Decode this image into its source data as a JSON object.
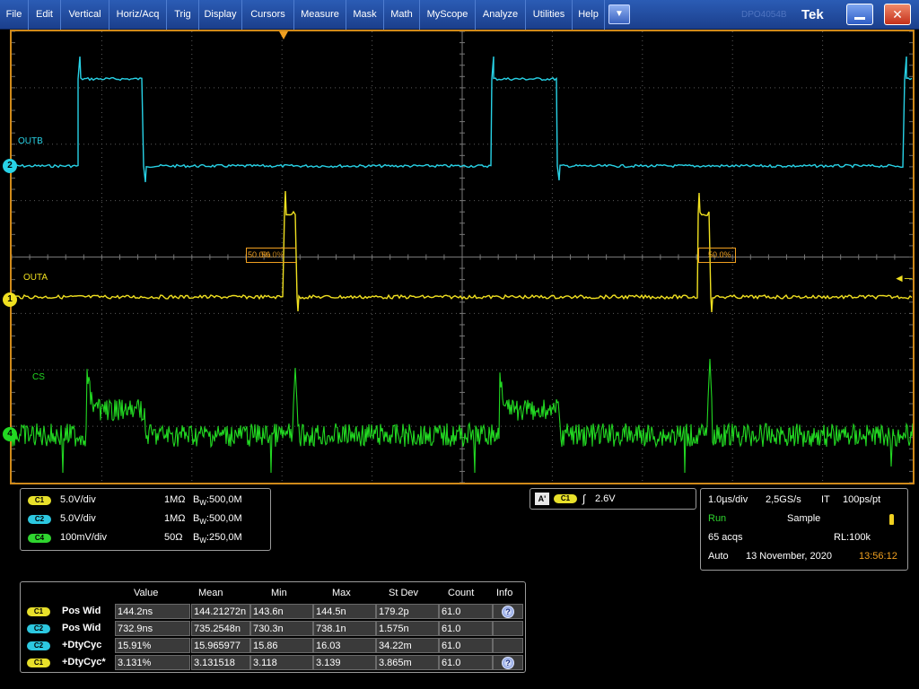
{
  "menu": {
    "items": [
      "File",
      "Edit",
      "Vertical",
      "Horiz/Acq",
      "Trig",
      "Display",
      "Cursors",
      "Measure",
      "Mask",
      "Math",
      "MyScope",
      "Analyze",
      "Utilities",
      "Help"
    ],
    "dropdown_icon": "chevron-down-icon",
    "brand": "Tek",
    "ghost_label": "DPO4054B"
  },
  "channels": {
    "ch1": {
      "marker": "1",
      "label": "OUTA",
      "color": "#f0e020"
    },
    "ch2": {
      "marker": "2",
      "label": "OUTB",
      "color": "#28d2e6"
    },
    "ch4": {
      "marker": "4",
      "label": "CS",
      "color": "#22d822"
    }
  },
  "ref_markers": {
    "left": "50.0%",
    "right": "50.0%",
    "overlap": "50.0%"
  },
  "vertical_settings": [
    {
      "badge": "C1",
      "scale": "5.0V/div",
      "impedance": "1MΩ",
      "bw": "500,0M"
    },
    {
      "badge": "C2",
      "scale": "5.0V/div",
      "impedance": "1MΩ",
      "bw": "500,0M"
    },
    {
      "badge": "C4",
      "scale": "100mV/div",
      "impedance": "50Ω",
      "bw": "250,0M"
    }
  ],
  "bw_prefix": "B",
  "bw_sub": "W",
  "bw_sep": ":",
  "trigger": {
    "mode": "A'",
    "badge": "C1",
    "level": "2.6V"
  },
  "acquisition": {
    "timebase": "1.0µs/div",
    "sample_rate": "2,5GS/s",
    "mode_it": "IT",
    "resolution": "100ps/pt",
    "state": "Run",
    "acq_mode": "Sample",
    "acqs": "65 acqs",
    "record_length": "RL:100k",
    "trigger_mode": "Auto",
    "date": "13 November, 2020",
    "time": "13:56:12"
  },
  "measurements": {
    "headers": [
      "Value",
      "Mean",
      "Min",
      "Max",
      "St Dev",
      "Count",
      "Info"
    ],
    "rows": [
      {
        "badge": "C1",
        "name": "Pos Wid",
        "value": "144.2ns",
        "mean": "144.21272n",
        "min": "143.6n",
        "max": "144.5n",
        "stdev": "179.2p",
        "count": "61.0",
        "info": true
      },
      {
        "badge": "C2",
        "name": "Pos Wid",
        "value": "732.9ns",
        "mean": "735.2548n",
        "min": "730.3n",
        "max": "738.1n",
        "stdev": "1.575n",
        "count": "61.0",
        "info": false
      },
      {
        "badge": "C2",
        "name": "+DtyCyc",
        "value": "15.91%",
        "mean": "15.965977",
        "min": "15.86",
        "max": "16.03",
        "stdev": "34.22m",
        "count": "61.0",
        "info": false
      },
      {
        "badge": "C1",
        "name": "+DtyCyc*",
        "value": "3.131%",
        "mean": "3.131518",
        "min": "3.118",
        "max": "3.139",
        "stdev": "3.865m",
        "count": "61.0",
        "info": true
      }
    ]
  },
  "colors": {
    "accent_frame": "#d08a1a",
    "time_orange": "#f0a020",
    "run_green": "#2fd52f",
    "grid": "#5a5a5a"
  }
}
